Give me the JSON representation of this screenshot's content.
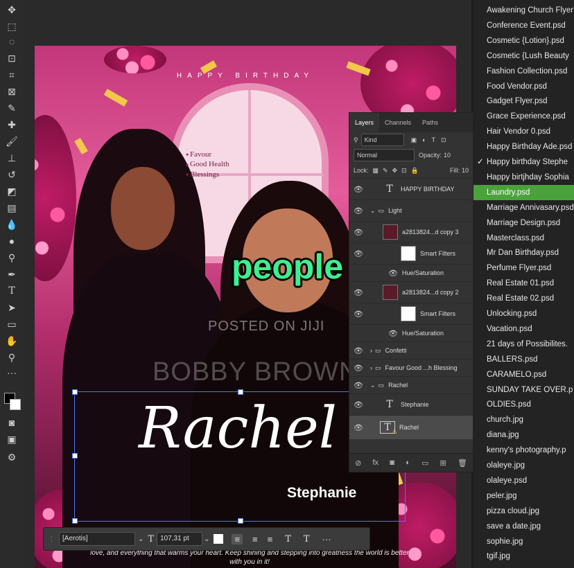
{
  "toolbar": {
    "tools": [
      "move-tool",
      "marquee-tool",
      "lasso-tool",
      "object-select-tool",
      "crop-tool",
      "frame-tool",
      "eyedropper-tool",
      "healing-tool",
      "brush-tool",
      "stamp-tool",
      "history-brush-tool",
      "eraser-tool",
      "gradient-tool",
      "blur-tool",
      "dodge-tool",
      "pen-tool",
      "type-tool",
      "path-select-tool",
      "rectangle-tool",
      "hand-tool",
      "zoom-tool",
      "more-tools"
    ]
  },
  "flyer": {
    "header": "HAPPY BIRTHDAY",
    "blessings": [
      "Favour",
      "Good Health",
      "Blessings"
    ],
    "name_script": "Rachel",
    "name_sub": "Stephanie",
    "footer": "love, and everything that warms your heart. Keep shining and stepping into greatness the world is better with you in it!"
  },
  "overlay": {
    "caption": "people",
    "watermark_small": "POSTED ON JIJI",
    "watermark_large": "BOBBY BROWN"
  },
  "layers_panel": {
    "tabs": [
      "Layers",
      "Channels",
      "Paths"
    ],
    "filter": "Kind",
    "blend_mode": "Normal",
    "opacity_label": "Opacity:",
    "opacity_value": "10",
    "lock_label": "Lock:",
    "fill_label": "Fill:",
    "fill_value": "10",
    "layers": [
      {
        "name": "HAPPY BIRTHDAY",
        "type": "text"
      },
      {
        "name": "Light",
        "type": "group"
      },
      {
        "name": "a2813824...d copy 3",
        "type": "image"
      },
      {
        "name": "Smart Filters",
        "type": "filter"
      },
      {
        "name": "Hue/Saturation",
        "type": "filter-item"
      },
      {
        "name": "a2813824...d copy 2",
        "type": "image"
      },
      {
        "name": "Smart Filters",
        "type": "filter"
      },
      {
        "name": "Hue/Saturation",
        "type": "filter-item"
      },
      {
        "name": "Confetti",
        "type": "group"
      },
      {
        "name": "Favour Good ...h Blessing",
        "type": "group"
      },
      {
        "name": "Rachel",
        "type": "group"
      },
      {
        "name": "Stephanie",
        "type": "text"
      },
      {
        "name": "Rachel",
        "type": "text-warning"
      }
    ]
  },
  "recent_files": [
    "Awakening Church Flyer",
    "Conference Event.psd",
    "Cosmetic {Lotion}.psd",
    "Cosmetic {Lush Beauty",
    "Fashion Collection.psd",
    "Food Vendor.psd",
    "Gadget Flyer.psd",
    "Grace Experience.psd",
    "Hair Vendor 0.psd",
    "Happy Birthday Ade.psd",
    "Happy birthday Stephe",
    "Happy birtjhday Sophia",
    "Laundry.psd",
    "Marriage Annivasary.psd",
    "Marriage Design.psd",
    "Masterclass.psd",
    "Mr Dan Birthday.psd",
    "Perfume Flyer.psd",
    "Real Estate 01.psd",
    "Real Estate 02.psd",
    "Unlocking.psd",
    "Vacation.psd",
    "21 days of Possibilites.",
    "BALLERS.psd",
    "CARAMELO.psd",
    "SUNDAY TAKE OVER.p",
    "OLDIES.psd",
    "church.jpg",
    "diana.jpg",
    "kenny's photography.p",
    "olaleye.jpg",
    "olaleye.psd",
    "peler.jpg",
    "pizza cloud.jpg",
    "save a date.jpg",
    "sophie.jpg",
    "tgif.jpg"
  ],
  "recent_files_checked_index": 10,
  "recent_files_highlight_index": 12,
  "options_bar": {
    "font": "[Aerotis]",
    "size": "107,31 pt"
  },
  "colors": {
    "accent_highlight": "#4aa23a",
    "caption_green": "#3cf08f",
    "selection_blue": "#4d74ff"
  }
}
